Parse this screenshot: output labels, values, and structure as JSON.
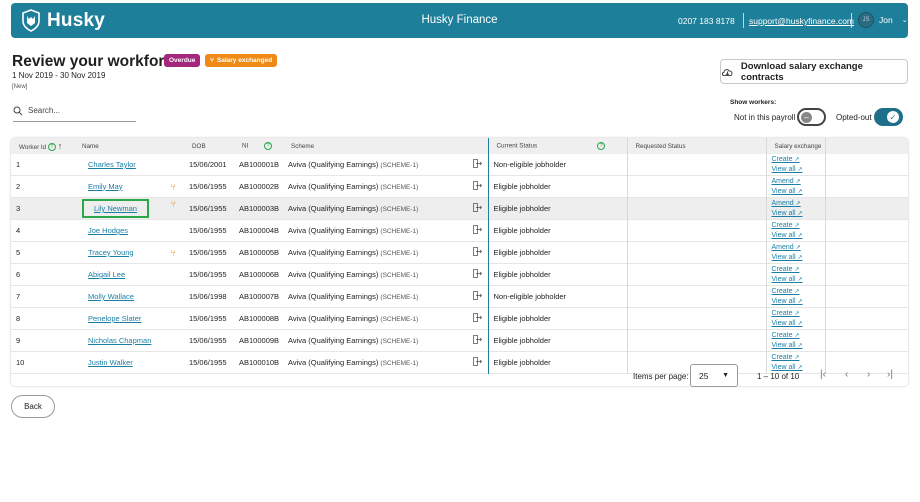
{
  "header": {
    "logo_text": "Husky",
    "company": "Husky Finance",
    "phone": "0207 183 8178",
    "support_email": "support@huskyfinance.com",
    "user_name": "Jon",
    "brand_color": "#1e7f9a"
  },
  "page": {
    "title": "Review your workforce",
    "badge_overdue": "Overdue",
    "badge_salary": "Salary exchanged",
    "date_range": "1 Nov 2019 - 30 Nov 2019",
    "new_tag": "[New]",
    "search_placeholder": "Search..."
  },
  "actions": {
    "download_label": "Download salary exchange contracts",
    "show_workers_label": "Show workers:",
    "toggle_not_in_payroll": "Not in this payroll",
    "toggle_not_in_payroll_on": false,
    "toggle_opted_out": "Opted-out",
    "toggle_opted_out_on": true
  },
  "table": {
    "headers": {
      "worker_id": "Worker Id",
      "name": "Name",
      "dob": "DOB",
      "ni": "NI",
      "scheme": "Scheme",
      "current_status": "Current Status",
      "requested_status": "Requested Status",
      "salary_exchange": "Salary exchange"
    },
    "rows": [
      {
        "id": "1",
        "name": "Charles Taylor",
        "fork": false,
        "dob": "15/06/2001",
        "ni": "AB100001B",
        "scheme": "Aviva (Qualifying Earnings)",
        "scheme_code": "(SCHEME-1)",
        "status": "Non-eligible jobholder",
        "sx_action": "Create",
        "sx_view": "View all"
      },
      {
        "id": "2",
        "name": "Emily May",
        "fork": true,
        "dob": "15/06/1955",
        "ni": "AB100002B",
        "scheme": "Aviva (Qualifying Earnings)",
        "scheme_code": "(SCHEME-1)",
        "status": "Eligible jobholder",
        "sx_action": "Amend",
        "sx_view": "View all"
      },
      {
        "id": "3",
        "name": "Lily Newman",
        "fork": true,
        "dob": "15/06/1955",
        "ni": "AB100003B",
        "scheme": "Aviva (Qualifying Earnings)",
        "scheme_code": "(SCHEME-1)",
        "status": "Eligible jobholder",
        "sx_action": "Amend",
        "sx_view": "View all"
      },
      {
        "id": "4",
        "name": "Joe Hodges",
        "fork": false,
        "dob": "15/06/1955",
        "ni": "AB100004B",
        "scheme": "Aviva (Qualifying Earnings)",
        "scheme_code": "(SCHEME-1)",
        "status": "Eligible jobholder",
        "sx_action": "Create",
        "sx_view": "View all"
      },
      {
        "id": "5",
        "name": "Tracey Young",
        "fork": true,
        "dob": "15/06/1955",
        "ni": "AB100005B",
        "scheme": "Aviva (Qualifying Earnings)",
        "scheme_code": "(SCHEME-1)",
        "status": "Eligible jobholder",
        "sx_action": "Amend",
        "sx_view": "View all"
      },
      {
        "id": "6",
        "name": "Abigail Lee",
        "fork": false,
        "dob": "15/06/1955",
        "ni": "AB100006B",
        "scheme": "Aviva (Qualifying Earnings)",
        "scheme_code": "(SCHEME-1)",
        "status": "Eligible jobholder",
        "sx_action": "Create",
        "sx_view": "View all"
      },
      {
        "id": "7",
        "name": "Molly Wallace",
        "fork": false,
        "dob": "15/06/1998",
        "ni": "AB100007B",
        "scheme": "Aviva (Qualifying Earnings)",
        "scheme_code": "(SCHEME-1)",
        "status": "Non-eligible jobholder",
        "sx_action": "Create",
        "sx_view": "View all"
      },
      {
        "id": "8",
        "name": "Penelope Slater",
        "fork": false,
        "dob": "15/06/1955",
        "ni": "AB100008B",
        "scheme": "Aviva (Qualifying Earnings)",
        "scheme_code": "(SCHEME-1)",
        "status": "Eligible jobholder",
        "sx_action": "Create",
        "sx_view": "View all"
      },
      {
        "id": "9",
        "name": "Nicholas Chapman",
        "fork": false,
        "dob": "15/06/1955",
        "ni": "AB100009B",
        "scheme": "Aviva (Qualifying Earnings)",
        "scheme_code": "(SCHEME-1)",
        "status": "Eligible jobholder",
        "sx_action": "Create",
        "sx_view": "View all"
      },
      {
        "id": "10",
        "name": "Justin Walker",
        "fork": false,
        "dob": "15/06/1955",
        "ni": "AB100010B",
        "scheme": "Aviva (Qualifying Earnings)",
        "scheme_code": "(SCHEME-1)",
        "status": "Eligible jobholder",
        "sx_action": "Create",
        "sx_view": "View all"
      }
    ]
  },
  "pager": {
    "items_per_page_label": "Items per page:",
    "items_per_page": "25",
    "range": "1 – 10 of 10"
  },
  "footer": {
    "back_label": "Back"
  }
}
